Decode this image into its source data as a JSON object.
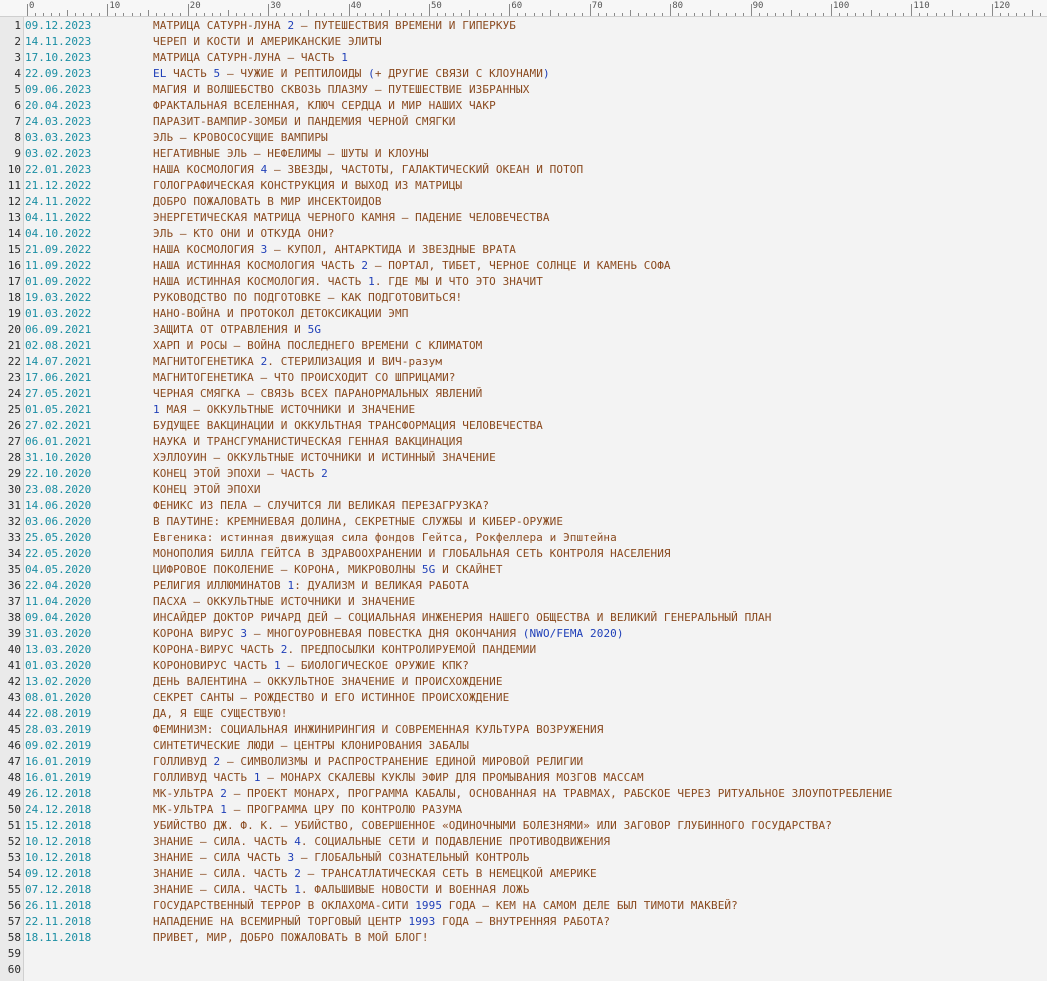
{
  "ruler": {
    "labels": [
      "0",
      "10",
      "20",
      "30",
      "40",
      "50",
      "60",
      "70",
      "80",
      "90",
      "100",
      "110",
      "120"
    ]
  },
  "rows": [
    {
      "n": "1",
      "date": "09.12.2023",
      "title": "МАТРИЦА САТУРН-ЛУНА 2 – ПУТЕШЕСТВИЯ ВРЕМЕНИ И ГИПЕРКУБ"
    },
    {
      "n": "2",
      "date": "14.11.2023",
      "title": "ЧЕРЕП И КОСТИ И АМЕРИКАНСКИЕ ЭЛИТЫ"
    },
    {
      "n": "3",
      "date": "17.10.2023",
      "title": "МАТРИЦА САТУРН-ЛУНА – ЧАСТЬ 1"
    },
    {
      "n": "4",
      "date": "22.09.2023",
      "title": "EL ЧАСТЬ 5 – ЧУЖИЕ И РЕПТИЛОИДЫ (+ ДРУГИЕ СВЯЗИ С КЛОУНАМИ)"
    },
    {
      "n": "5",
      "date": "09.06.2023",
      "title": "МАГИЯ И ВОЛШЕБСТВО СКВОЗЬ ПЛАЗМУ – ПУТЕШЕСТВИЕ ИЗБРАННЫХ"
    },
    {
      "n": "6",
      "date": "20.04.2023",
      "title": "ФРАКТАЛЬНАЯ ВСЕЛЕННАЯ, КЛЮЧ СЕРДЦА И МИР НАШИХ ЧАКР"
    },
    {
      "n": "7",
      "date": "24.03.2023",
      "title": "ПАРАЗИТ-ВАМПИР-ЗОМБИ И ПАНДЕМИЯ ЧЕРНОЙ СМЯГКИ"
    },
    {
      "n": "8",
      "date": "03.03.2023",
      "title": "ЭЛЬ – КРОВОСОСУЩИЕ ВАМПИРЫ"
    },
    {
      "n": "9",
      "date": "03.02.2023",
      "title": "НЕГАТИВНЫЕ ЭЛЬ – НЕФЕЛИМЫ – ШУТЫ И КЛОУНЫ"
    },
    {
      "n": "10",
      "date": "22.01.2023",
      "title": "НАША КОСМОЛОГИЯ 4 – ЗВЕЗДЫ, ЧАСТОТЫ, ГАЛАКТИЧЕСКИЙ ОКЕАН И ПОТОП"
    },
    {
      "n": "11",
      "date": "21.12.2022",
      "title": "ГОЛОГРАФИЧЕСКАЯ КОНСТРУКЦИЯ И ВЫХОД ИЗ МАТРИЦЫ"
    },
    {
      "n": "12",
      "date": "24.11.2022",
      "title": "ДОБРО ПОЖАЛОВАТЬ В МИР ИНСЕКТОИДОВ"
    },
    {
      "n": "13",
      "date": "04.11.2022",
      "title": "ЭНЕРГЕТИЧЕСКАЯ МАТРИЦА ЧЕРНОГО КАМНЯ – ПАДЕНИЕ ЧЕЛОВЕЧЕСТВА"
    },
    {
      "n": "14",
      "date": "04.10.2022",
      "title": "ЭЛЬ – КТО ОНИ И ОТКУДА ОНИ?"
    },
    {
      "n": "15",
      "date": "21.09.2022",
      "title": "НАША КОСМОЛОГИЯ 3 – КУПОЛ, АНТАРКТИДА И ЗВЕЗДНЫЕ ВРАТА"
    },
    {
      "n": "16",
      "date": "11.09.2022",
      "title": "НАША ИСТИННАЯ КОСМОЛОГИЯ ЧАСТЬ 2 – ПОРТАЛ, ТИБЕТ, ЧЕРНОЕ СОЛНЦЕ И КАМЕНЬ СОФА"
    },
    {
      "n": "17",
      "date": "01.09.2022",
      "title": "НАША ИСТИННАЯ КОСМОЛОГИЯ. ЧАСТЬ 1. ГДЕ МЫ И ЧТО ЭТО ЗНАЧИТ"
    },
    {
      "n": "18",
      "date": "19.03.2022",
      "title": "РУКОВОДСТВО ПО ПОДГОТОВКЕ – КАК ПОДГОТОВИТЬСЯ!"
    },
    {
      "n": "19",
      "date": "01.03.2022",
      "title": "НАНО-ВОЙНА И ПРОТОКОЛ ДЕТОКСИКАЦИИ ЭМП"
    },
    {
      "n": "20",
      "date": "06.09.2021",
      "title": "ЗАЩИТА ОТ ОТРАВЛЕНИЯ И 5G"
    },
    {
      "n": "21",
      "date": "02.08.2021",
      "title": "ХАРП И РОСЫ – ВОЙНА ПОСЛЕДНЕГО ВРЕМЕНИ С КЛИМАТОМ"
    },
    {
      "n": "22",
      "date": "14.07.2021",
      "title": "МАГНИТОГЕНЕТИКА 2. СТЕРИЛИЗАЦИЯ И ВИЧ-разум"
    },
    {
      "n": "23",
      "date": "17.06.2021",
      "title": "МАГНИТОГЕНЕТИКА – ЧТО ПРОИСХОДИТ СО ШПРИЦАМИ?"
    },
    {
      "n": "24",
      "date": "27.05.2021",
      "title": "ЧЕРНАЯ СМЯГКА – СВЯЗЬ ВСЕХ ПАРАНОРМАЛЬНЫХ ЯВЛЕНИЙ"
    },
    {
      "n": "25",
      "date": "01.05.2021",
      "title": "1 МАЯ – ОККУЛЬТНЫЕ ИСТОЧНИКИ И ЗНАЧЕНИЕ"
    },
    {
      "n": "26",
      "date": "27.02.2021",
      "title": "БУДУЩЕЕ ВАКЦИНАЦИИ И ОККУЛЬТНАЯ ТРАНСФОРМАЦИЯ ЧЕЛОВЕЧЕСТВА"
    },
    {
      "n": "27",
      "date": "06.01.2021",
      "title": "НАУКА И ТРАНСГУМАНИСТИЧЕСКАЯ ГЕННАЯ ВАКЦИНАЦИЯ"
    },
    {
      "n": "28",
      "date": "31.10.2020",
      "title": "ХЭЛЛОУИН – ОККУЛЬТНЫЕ ИСТОЧНИКИ И ИСТИННЫЙ ЗНАЧЕНИЕ"
    },
    {
      "n": "29",
      "date": "22.10.2020",
      "title": "КОНЕЦ ЭТОЙ ЭПОХИ – ЧАСТЬ 2"
    },
    {
      "n": "30",
      "date": "23.08.2020",
      "title": "КОНЕЦ ЭТОЙ ЭПОХИ"
    },
    {
      "n": "31",
      "date": "14.06.2020",
      "title": "ФЕНИКС ИЗ ПЕЛА – СЛУЧИТСЯ ЛИ ВЕЛИКАЯ ПЕРЕЗАГРУЗКА?"
    },
    {
      "n": "32",
      "date": "03.06.2020",
      "title": "В ПАУТИНЕ: КРЕМНИЕВАЯ ДОЛИНА, СЕКРЕТНЫЕ СЛУЖБЫ И КИБЕР-ОРУЖИЕ"
    },
    {
      "n": "33",
      "date": "25.05.2020",
      "title": "Евгеника: истинная движущая сила фондов Гейтса, Рокфеллера и Эпштейна"
    },
    {
      "n": "34",
      "date": "22.05.2020",
      "title": "МОНОПОЛИЯ БИЛЛА ГЕЙТСА В ЗДРАВООХРАНЕНИИ И ГЛОБАЛЬНАЯ СЕТЬ КОНТРОЛЯ НАСЕЛЕНИЯ"
    },
    {
      "n": "35",
      "date": "04.05.2020",
      "title": "ЦИФРОВОЕ ПОКОЛЕНИЕ – КОРОНА, МИКРОВОЛНЫ 5G И СКАЙНЕТ"
    },
    {
      "n": "36",
      "date": "22.04.2020",
      "title": "РЕЛИГИЯ ИЛЛЮМИНАТОВ 1: ДУАЛИЗМ И ВЕЛИКАЯ РАБОТА"
    },
    {
      "n": "37",
      "date": "11.04.2020",
      "title": "ПАСХА – ОККУЛЬТНЫЕ ИСТОЧНИКИ И ЗНАЧЕНИЕ"
    },
    {
      "n": "38",
      "date": "09.04.2020",
      "title": "ИНСАЙДЕР ДОКТОР РИЧАРД ДЕЙ – СОЦИАЛЬНАЯ ИНЖЕНЕРИЯ НАШЕГО ОБЩЕСТВА И ВЕЛИКИЙ ГЕНЕРАЛЬНЫЙ ПЛАН"
    },
    {
      "n": "39",
      "date": "31.03.2020",
      "title": "КОРОНА ВИРУС 3 – МНОГОУРОВНЕВАЯ ПОВЕСТКА ДНЯ ОКОНЧАНИЯ (NWO/FEMA 2020)"
    },
    {
      "n": "40",
      "date": "13.03.2020",
      "title": "КОРОНА-ВИРУС ЧАСТЬ 2. ПРЕДПОСЫЛКИ КОНТРОЛИРУЕМОЙ ПАНДЕМИИ"
    },
    {
      "n": "41",
      "date": "01.03.2020",
      "title": "КОРОНОВИРУС ЧАСТЬ 1 – БИОЛОГИЧЕСКОЕ ОРУЖИЕ КПК?"
    },
    {
      "n": "42",
      "date": "13.02.2020",
      "title": "ДЕНЬ ВАЛЕНТИНА – ОККУЛЬТНОЕ ЗНАЧЕНИЕ И ПРОИСХОЖДЕНИЕ"
    },
    {
      "n": "43",
      "date": "08.01.2020",
      "title": "СЕКРЕТ САНТЫ – РОЖДЕСТВО И ЕГО ИСТИННОЕ ПРОИСХОЖДЕНИЕ"
    },
    {
      "n": "44",
      "date": "22.08.2019",
      "title": "ДА, Я ЕЩЕ СУЩЕСТВУЮ!"
    },
    {
      "n": "45",
      "date": "28.03.2019",
      "title": "ФЕМИНИЗМ: СОЦИАЛЬНАЯ ИНЖИНИРИНГИЯ И СОВРЕМЕННАЯ КУЛЬТУРА ВОЗРУЖЕНИЯ"
    },
    {
      "n": "46",
      "date": "09.02.2019",
      "title": "СИНТЕТИЧЕСКИЕ ЛЮДИ – ЦЕНТРЫ КЛОНИРОВАНИЯ ЗАБАЛЫ"
    },
    {
      "n": "47",
      "date": "16.01.2019",
      "title": "ГОЛЛИВУД 2 – СИМВОЛИЗМЫ И РАСПРОСТРАНЕНИЕ ЕДИНОЙ МИРОВОЙ РЕЛИГИИ"
    },
    {
      "n": "48",
      "date": "16.01.2019",
      "title": "ГОЛЛИВУД ЧАСТЬ 1 – МОНАРХ СКАЛЕВЫ КУКЛЫ ЭФИР ДЛЯ ПРОМЫВАНИЯ МОЗГОВ МАССАМ"
    },
    {
      "n": "49",
      "date": "26.12.2018",
      "title": "МК-УЛЬТРА 2 – ПРОЕКТ МОНАРХ, ПРОГРАММА КАБАЛЫ, ОСНОВАННАЯ НА ТРАВМАХ, РАБСКОЕ ЧЕРЕЗ РИТУАЛЬНОЕ ЗЛОУПОТРЕБЛЕНИЕ"
    },
    {
      "n": "50",
      "date": "24.12.2018",
      "title": "МК-УЛЬТРА 1 – ПРОГРАММА ЦРУ ПО КОНТРОЛЮ РАЗУМА"
    },
    {
      "n": "51",
      "date": "15.12.2018",
      "title": "УБИЙСТВО ДЖ. Ф. К. – УБИЙСТВО, СОВЕРШЕННОЕ «ОДИНОЧНЫМИ БОЛЕЗНЯМИ» ИЛИ ЗАГОВОР ГЛУБИННОГО ГОСУДАРСТВА?"
    },
    {
      "n": "52",
      "date": "10.12.2018",
      "title": "ЗНАНИЕ – СИЛА. ЧАСТЬ 4. СОЦИАЛЬНЫЕ СЕТИ И ПОДАВЛЕНИЕ ПРОТИВОДВИЖЕНИЯ"
    },
    {
      "n": "53",
      "date": "10.12.2018",
      "title": "ЗНАНИЕ – СИЛА ЧАСТЬ 3 – ГЛОБАЛЬНЫЙ СОЗНАТЕЛЬНЫЙ КОНТРОЛЬ"
    },
    {
      "n": "54",
      "date": "09.12.2018",
      "title": "ЗНАНИЕ – СИЛА. ЧАСТЬ 2 – ТРАНСАТЛАТИЧЕСКАЯ СЕТЬ В НЕМЕЦКОЙ АМЕРИКЕ"
    },
    {
      "n": "55",
      "date": "07.12.2018",
      "title": "ЗНАНИЕ – СИЛА. ЧАСТЬ 1. ФАЛЬШИВЫЕ НОВОСТИ И ВОЕННАЯ ЛОЖЬ"
    },
    {
      "n": "56",
      "date": "26.11.2018",
      "title": "ГОСУДАРСТВЕННЫЙ ТЕРРОР В ОКЛАХОМА-СИТИ 1995 ГОДА – КЕМ НА САМОМ ДЕЛЕ БЫЛ ТИМОТИ МАКВЕЙ?"
    },
    {
      "n": "57",
      "date": "22.11.2018",
      "title": "НАПАДЕНИЕ НА ВСЕМИРНЫЙ ТОРГОВЫЙ ЦЕНТР 1993 ГОДА – ВНУТРЕННЯЯ РАБОТА?"
    },
    {
      "n": "58",
      "date": "18.11.2018",
      "title": "ПРИВЕТ, МИР, ДОБРО ПОЖАЛОВАТЬ В МОЙ БЛОГ!"
    },
    {
      "n": "59",
      "date": "",
      "title": ""
    },
    {
      "n": "60",
      "date": "",
      "title": ""
    }
  ]
}
